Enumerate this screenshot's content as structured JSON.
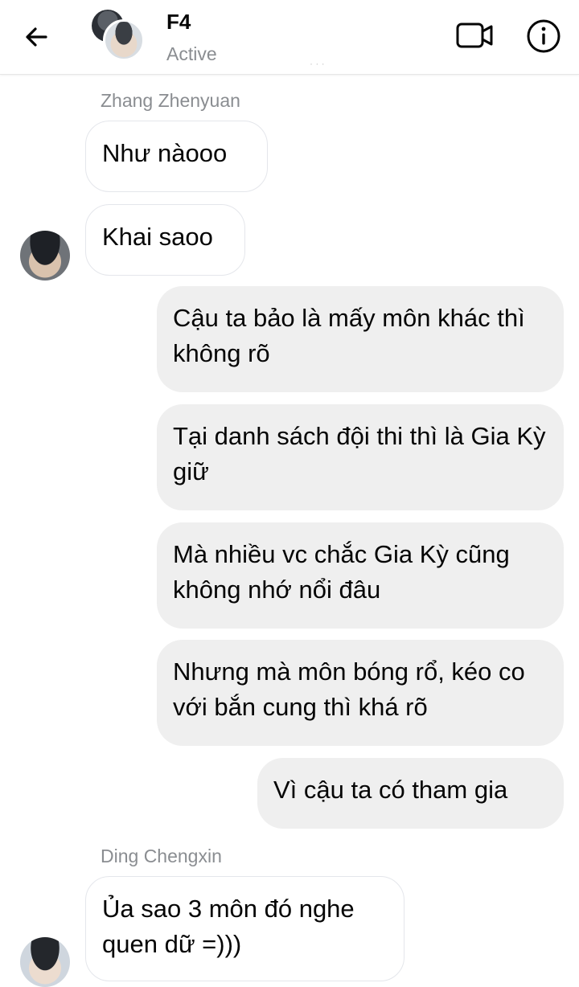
{
  "header": {
    "title": "F4",
    "status": "Active",
    "back_icon": "arrow-left-icon",
    "video_icon": "video-camera-icon",
    "info_icon": "info-icon"
  },
  "messages": [
    {
      "sender": "Zhang Zhenyuan",
      "direction": "incoming",
      "text": "Như nàooo"
    },
    {
      "direction": "incoming",
      "text": "Khai saoo"
    },
    {
      "direction": "outgoing",
      "text": "Cậu ta bảo là mấy môn khác thì không rõ"
    },
    {
      "direction": "outgoing",
      "text": "Tại danh sách đội thi thì là Gia Kỳ giữ"
    },
    {
      "direction": "outgoing",
      "text": "Mà nhiều vc chắc Gia Kỳ cũng không nhớ nổi đâu"
    },
    {
      "direction": "outgoing",
      "text": "Nhưng mà môn bóng rổ, kéo co với bắn cung thì khá rõ"
    },
    {
      "direction": "outgoing",
      "text": "Vì cậu ta có tham gia"
    },
    {
      "sender": "Ding Chengxin",
      "direction": "incoming",
      "text": "Ủa sao 3 môn đó nghe quen dữ =)))"
    }
  ],
  "colors": {
    "incoming_bubble": "#ffffff",
    "outgoing_bubble": "#efefef",
    "secondary_text": "#8a8d91",
    "primary_text": "#050505"
  }
}
